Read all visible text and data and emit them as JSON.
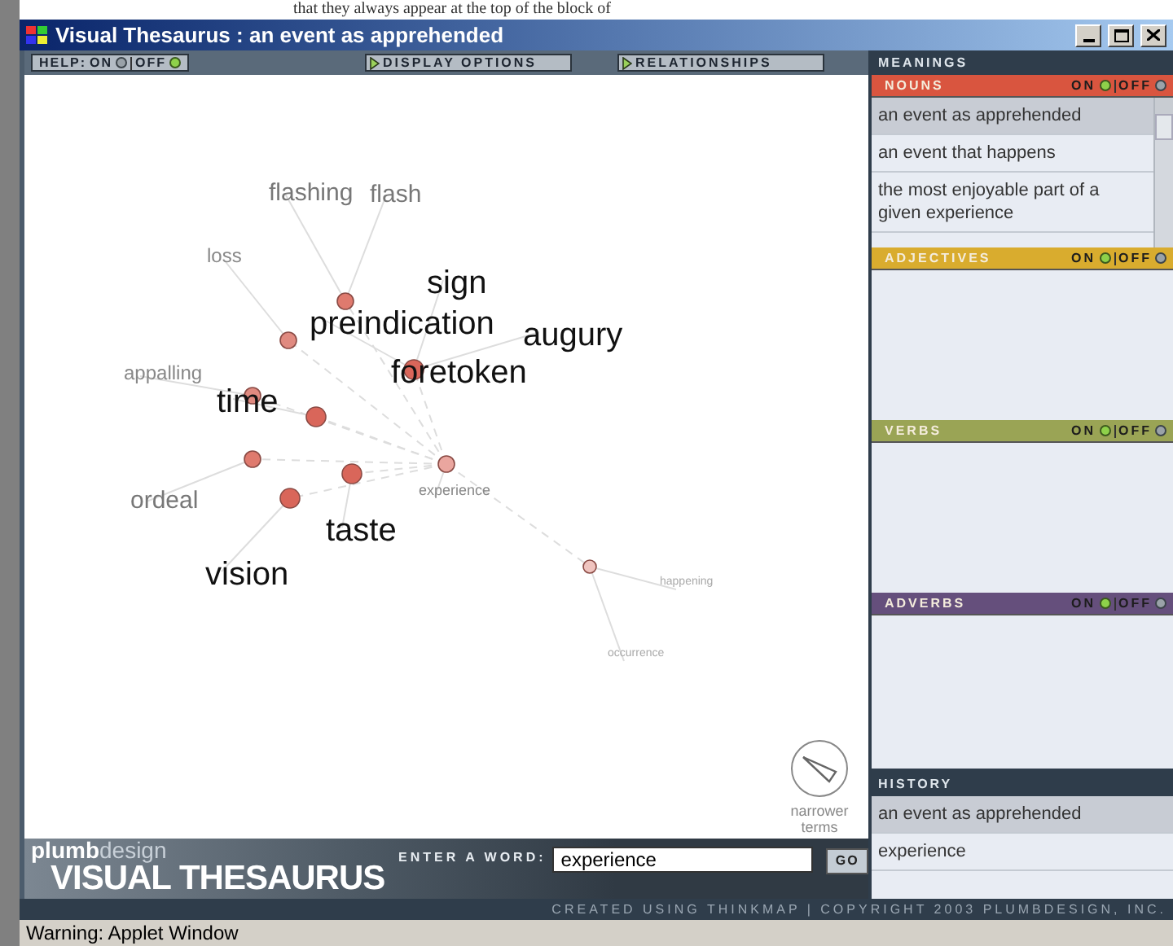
{
  "background_text": "that they always appear at the top of the block of",
  "window": {
    "title": "Visual Thesaurus : an event as apprehended"
  },
  "toolbar": {
    "help": {
      "label": "HELP:",
      "on_label": "ON",
      "off_label": "OFF",
      "on": false
    },
    "buttons": [
      "DISPLAY OPTIONS",
      "RELATIONSHIPS"
    ]
  },
  "graph": {
    "words": [
      {
        "label": "flashing",
        "kind": "weak"
      },
      {
        "label": "flash",
        "kind": "weak"
      },
      {
        "label": "loss",
        "kind": "minor"
      },
      {
        "label": "sign",
        "kind": "strong"
      },
      {
        "label": "preindication",
        "kind": "strong"
      },
      {
        "label": "augury",
        "kind": "strong"
      },
      {
        "label": "foretoken",
        "kind": "strong"
      },
      {
        "label": "appalling",
        "kind": "minor"
      },
      {
        "label": "time",
        "kind": "strong"
      },
      {
        "label": "ordeal",
        "kind": "weak"
      },
      {
        "label": "taste",
        "kind": "strong"
      },
      {
        "label": "vision",
        "kind": "strong"
      },
      {
        "label": "experience",
        "kind": "center"
      },
      {
        "label": "happening",
        "kind": "faint"
      },
      {
        "label": "occurrence",
        "kind": "faint"
      }
    ],
    "narrower": "narrower terms"
  },
  "branding": {
    "plumb": "plumb",
    "design": "design",
    "product": "VISUAL THESAURUS"
  },
  "word_entry": {
    "label": "ENTER A WORD:",
    "value": "experience",
    "button": "GO"
  },
  "meanings": {
    "title": "MEANINGS",
    "categories": [
      {
        "name": "NOUNS",
        "color": "#d9553f",
        "on_label": "ON",
        "off_label": "OFF",
        "on": true,
        "items": [
          {
            "text": "an event as apprehended",
            "selected": true
          },
          {
            "text": "an event that happens",
            "selected": false
          },
          {
            "text": "the most enjoyable part of a given experience",
            "selected": false
          }
        ]
      },
      {
        "name": "ADJECTIVES",
        "color": "#d9ac2e",
        "on_label": "ON",
        "off_label": "OFF",
        "on": true
      },
      {
        "name": "VERBS",
        "color": "#9aa455",
        "on_label": "ON",
        "off_label": "OFF",
        "on": true
      },
      {
        "name": "ADVERBS",
        "color": "#654f7c",
        "on_label": "ON",
        "off_label": "OFF",
        "on": true
      }
    ]
  },
  "history": {
    "title": "HISTORY",
    "items": [
      {
        "text": "an event as apprehended",
        "selected": true
      },
      {
        "text": "experience",
        "selected": false
      }
    ]
  },
  "footer": "CREATED USING THINKMAP | COPYRIGHT 2003 PLUMBDESIGN, INC.",
  "status_bar": "Warning: Applet Window"
}
